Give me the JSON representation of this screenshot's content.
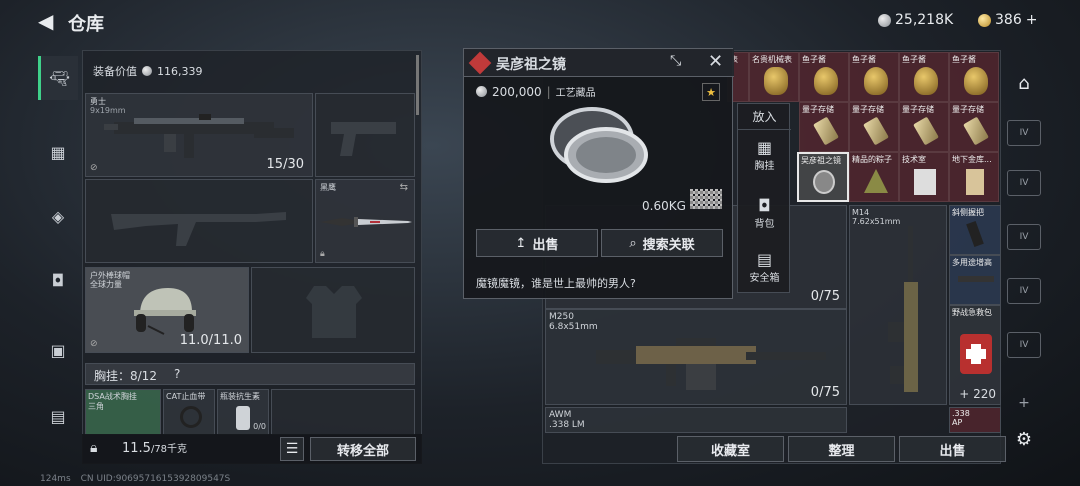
{
  "header": {
    "title": "仓库",
    "silver": "25,218K",
    "gold": "386",
    "gold_plus": "+"
  },
  "left": {
    "equipment_value_label": "装备价值",
    "equipment_value": "116,339",
    "weapon1": {
      "name": "勇士",
      "caliber": "9x19mm",
      "ammo": "15/30"
    },
    "knife": {
      "name": "黑鹰"
    },
    "helmet": {
      "name": "户外棒球帽",
      "sub": "全球力量",
      "durability": "11.0/11.0"
    },
    "chest_rig": {
      "label": "胸挂：8/12",
      "help": "?"
    },
    "rig_items": [
      "DSA战术胸挂",
      "三角",
      "CAT止血带",
      "瓶装抗生素",
      "0/0"
    ],
    "weight": "11.5",
    "weight_max": "/78千克",
    "transfer_all": "转移全部"
  },
  "popup": {
    "title": "吴彦祖之镜",
    "price": "200,000",
    "category": "工艺藏品",
    "weight": "0.60KG",
    "sell": "出售",
    "search": "搜索关联",
    "description": "魔镜魔镜，谁是世上最帅的男人?"
  },
  "context_menu": {
    "place": "放入",
    "items": [
      "胸挂",
      "背包",
      "安全箱"
    ]
  },
  "grid": {
    "row1": [
      "表",
      "名贵机械表",
      "鱼子酱",
      "鱼子酱",
      "鱼子酱",
      "鱼子酱"
    ],
    "row2": [
      "量子存储",
      "量子存储",
      "量子存储",
      "量子存储"
    ],
    "row3": [
      "吴彦祖之镜",
      "精品的粽子",
      "技术室",
      "地下金库..."
    ],
    "m14": {
      "name": "M14",
      "caliber": "7.62x51mm",
      "count": "0/75"
    },
    "grip": "斜侧握把",
    "scope": "多用途增高",
    "medkit": {
      "name": "野战急救包",
      "count": "220",
      "plus": "+"
    },
    "m250": {
      "name": "M250",
      "caliber": "6.8x51mm",
      "count": "0/75"
    },
    "awm": {
      "name": "AWM",
      "caliber": ".338 LM"
    },
    "ammo338": {
      "name": ".338",
      "sub": "AP"
    }
  },
  "bottom": {
    "collection": "收藏室",
    "sort": "整理",
    "sell": "出售"
  },
  "footer": {
    "ping": "124ms",
    "uid": "CN UID:9069571615392809547S"
  }
}
